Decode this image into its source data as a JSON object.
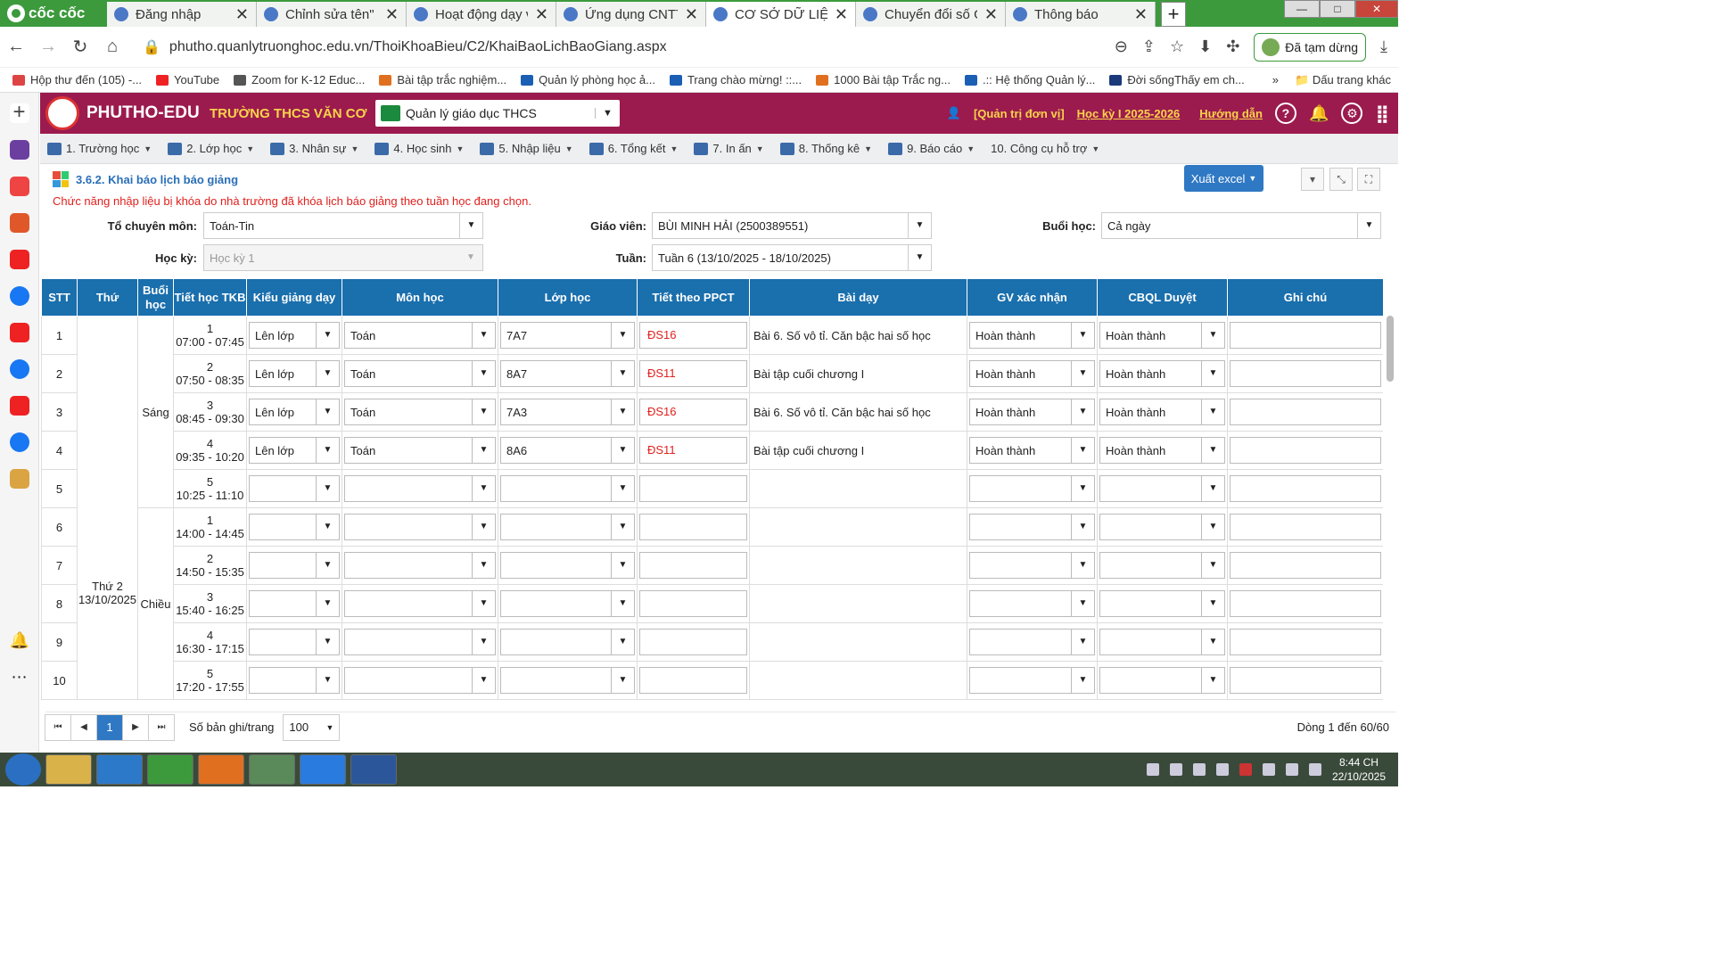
{
  "browser": {
    "brand": "cốc cốc",
    "tabs": [
      {
        "title": "Đăng nhập"
      },
      {
        "title": "Chỉnh sửa tên\" |"
      },
      {
        "title": "Hoạt động dạy v"
      },
      {
        "title": "Ứng dụng CNTT"
      },
      {
        "title": "CƠ SỞ DỮ LIỆU N",
        "active": true
      },
      {
        "title": "Chuyển đổi số G"
      },
      {
        "title": "Thông báo"
      }
    ],
    "url": "phutho.quanlytruonghoc.edu.vn/ThoiKhoaBieu/C2/KhaiBaoLichBaoGiang.aspx",
    "paused_label": "Đã tạm dừng",
    "bookmarks": [
      {
        "label": "Hộp thư đến (105) -...",
        "color": "#d44"
      },
      {
        "label": "YouTube",
        "color": "#e22"
      },
      {
        "label": "Zoom for K-12 Educ...",
        "color": "#555"
      },
      {
        "label": "Bài tập trắc nghiệm...",
        "color": "#e07020"
      },
      {
        "label": "Quản lý phòng học ả...",
        "color": "#1a5fb4"
      },
      {
        "label": "Trang chào mừng! ::...",
        "color": "#1a5fb4"
      },
      {
        "label": "1000 Bài tập Trắc ng...",
        "color": "#e07020"
      },
      {
        "label": ".:: Hệ thống Quản lý...",
        "color": "#1a5fb4"
      },
      {
        "label": "Đời sốngThấy em ch...",
        "color": "#1a3a7a"
      }
    ],
    "bookmarks_more": "»",
    "bookmarks_folder": "Dấu trang khác"
  },
  "app": {
    "brand": "PHUTHO-EDU",
    "school": "TRƯỜNG THCS VĂN CƠ",
    "system_select": "Quản lý giáo dục THCS",
    "role": "[Quản trị đơn vị]",
    "semester_link": "Học kỳ I 2025-2026",
    "help_link": "Hướng dẫn",
    "menu": [
      "1. Trường học",
      "2. Lớp học",
      "3. Nhân sự",
      "4. Học sinh",
      "5. Nhập liệu",
      "6. Tổng kết",
      "7. In ấn",
      "8. Thống kê",
      "9. Báo cáo",
      "10. Công cụ hỗ trợ"
    ],
    "page_title": "3.6.2. Khai báo lịch báo giảng",
    "export_label": "Xuất excel",
    "warning": "Chức năng nhập liệu bị khóa do nhà trường đã khóa lịch báo giảng theo tuần học đang chọn.",
    "filters": {
      "department_label": "Tổ chuyên môn:",
      "department": "Toán-Tin",
      "teacher_label": "Giáo viên:",
      "teacher": "BÙI MINH HẢI (2500389551)",
      "session_label": "Buổi học:",
      "session": "Cả ngày",
      "semester_label": "Học kỳ:",
      "semester": "Học kỳ 1",
      "week_label": "Tuần:",
      "week": "Tuần 6 (13/10/2025 - 18/10/2025)"
    },
    "columns": [
      "STT",
      "Thứ",
      "Buổi học",
      "Tiết học TKB",
      "Kiểu giảng dạy",
      "Môn học",
      "Lớp học",
      "Tiết theo PPCT",
      "Bài dạy",
      "GV xác nhận",
      "CBQL Duyệt",
      "Ghi chú"
    ],
    "day": {
      "name": "Thứ 2",
      "date": "13/10/2025"
    },
    "sessions": [
      "Sáng",
      "Chiều"
    ],
    "rows": [
      {
        "stt": "1",
        "tiet": "1",
        "time": "07:00 - 07:45",
        "kieu": "Lên lớp",
        "mon": "Toán",
        "lop": "7A7",
        "ppct": "ĐS16",
        "bai": "Bài 6. Số vô tỉ. Căn bậc hai số học",
        "gv": "Hoàn thành",
        "cbql": "Hoàn thành"
      },
      {
        "stt": "2",
        "tiet": "2",
        "time": "07:50 - 08:35",
        "kieu": "Lên lớp",
        "mon": "Toán",
        "lop": "8A7",
        "ppct": "ĐS11",
        "bai": "Bài tập cuối chương I",
        "gv": "Hoàn thành",
        "cbql": "Hoàn thành"
      },
      {
        "stt": "3",
        "tiet": "3",
        "time": "08:45 - 09:30",
        "kieu": "Lên lớp",
        "mon": "Toán",
        "lop": "7A3",
        "ppct": "ĐS16",
        "bai": "Bài 6. Số vô tỉ. Căn bậc hai số học",
        "gv": "Hoàn thành",
        "cbql": "Hoàn thành"
      },
      {
        "stt": "4",
        "tiet": "4",
        "time": "09:35 - 10:20",
        "kieu": "Lên lớp",
        "mon": "Toán",
        "lop": "8A6",
        "ppct": "ĐS11",
        "bai": "Bài tập cuối chương I",
        "gv": "Hoàn thành",
        "cbql": "Hoàn thành"
      },
      {
        "stt": "5",
        "tiet": "5",
        "time": "10:25 - 11:10",
        "kieu": "",
        "mon": "",
        "lop": "",
        "ppct": "",
        "bai": "",
        "gv": "",
        "cbql": ""
      },
      {
        "stt": "6",
        "tiet": "1",
        "time": "14:00 - 14:45",
        "kieu": "",
        "mon": "",
        "lop": "",
        "ppct": "",
        "bai": "",
        "gv": "",
        "cbql": ""
      },
      {
        "stt": "7",
        "tiet": "2",
        "time": "14:50 - 15:35",
        "kieu": "",
        "mon": "",
        "lop": "",
        "ppct": "",
        "bai": "",
        "gv": "",
        "cbql": ""
      },
      {
        "stt": "8",
        "tiet": "3",
        "time": "15:40 - 16:25",
        "kieu": "",
        "mon": "",
        "lop": "",
        "ppct": "",
        "bai": "",
        "gv": "",
        "cbql": ""
      },
      {
        "stt": "9",
        "tiet": "4",
        "time": "16:30 - 17:15",
        "kieu": "",
        "mon": "",
        "lop": "",
        "ppct": "",
        "bai": "",
        "gv": "",
        "cbql": ""
      },
      {
        "stt": "10",
        "tiet": "5",
        "time": "17:20 - 17:55",
        "kieu": "",
        "mon": "",
        "lop": "",
        "ppct": "",
        "bai": "",
        "gv": "",
        "cbql": ""
      }
    ],
    "pager": {
      "page": "1",
      "page_size_label": "Số bản ghi/trang",
      "page_size": "100",
      "info": "Dòng 1 đến 60/60"
    }
  },
  "taskbar": {
    "time": "8:44 CH",
    "date": "22/10/2025"
  }
}
